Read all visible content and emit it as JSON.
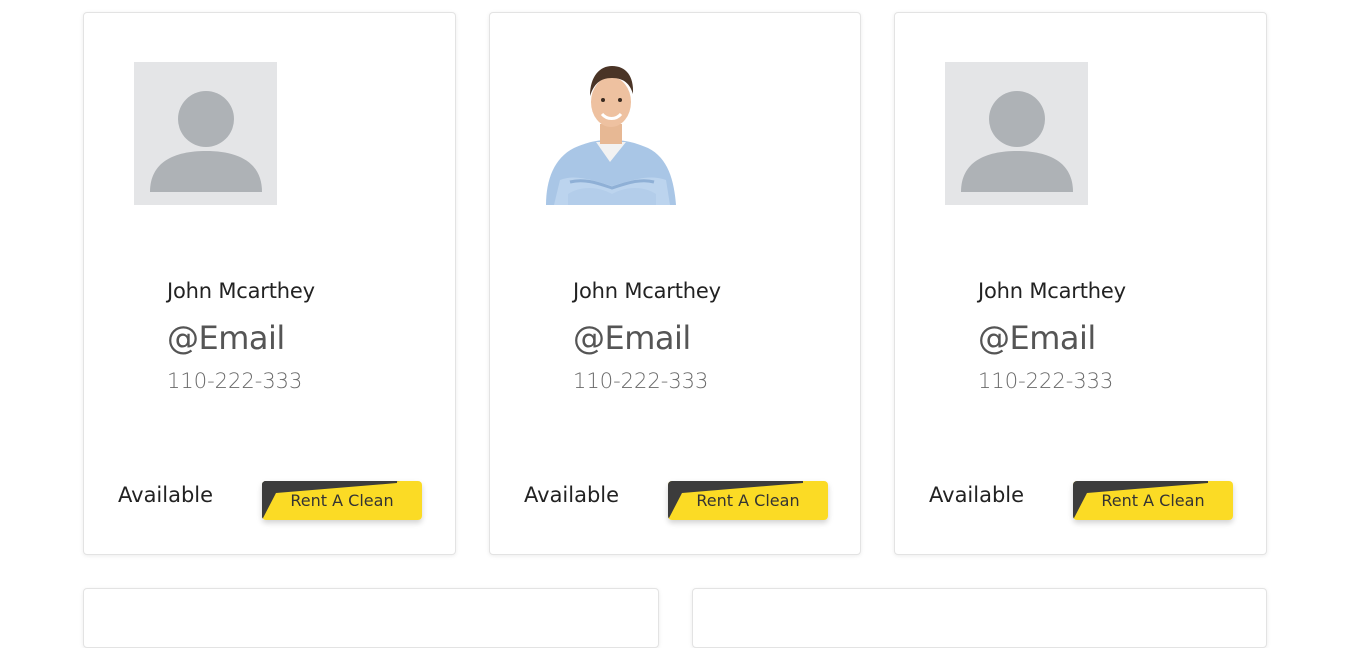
{
  "cards": [
    {
      "name": "John Mcarthey",
      "email": "@Email",
      "phone": "110-222-333",
      "status": "Available",
      "button_label": "Rent A Clean",
      "avatar": "placeholder-avatar-icon"
    },
    {
      "name": "John Mcarthey",
      "email": "@Email",
      "phone": "110-222-333",
      "status": "Available",
      "button_label": "Rent A Clean",
      "avatar": "man-photo"
    },
    {
      "name": "John Mcarthey",
      "email": "@Email",
      "phone": "110-222-333",
      "status": "Available",
      "button_label": "Rent A Clean",
      "avatar": "placeholder-avatar-icon"
    }
  ],
  "colors": {
    "button_yellow": "#fbdb25",
    "button_dark": "#3c3c3c",
    "placeholder_bg": "#e4e5e7",
    "placeholder_fg": "#aeb2b6"
  }
}
